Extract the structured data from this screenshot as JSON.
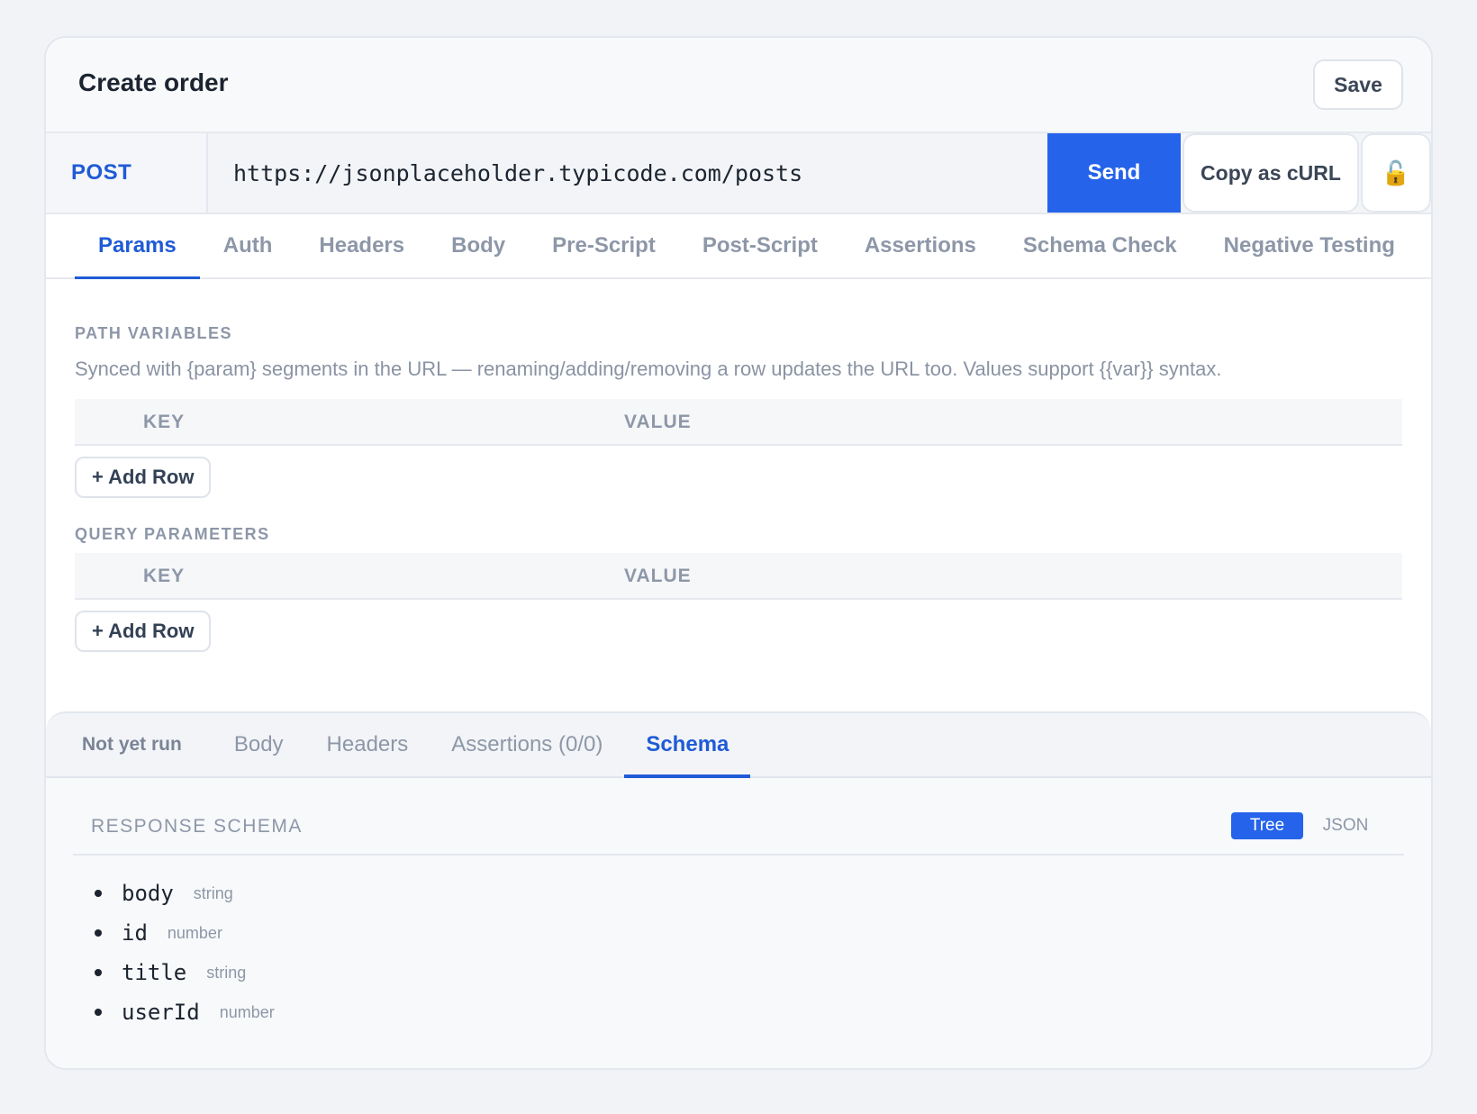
{
  "header": {
    "title": "Create order",
    "save_label": "Save"
  },
  "request": {
    "method": "POST",
    "url": "https://jsonplaceholder.typicode.com/posts",
    "send_label": "Send",
    "copy_curl_label": "Copy as cURL",
    "lock_icon": "lock-open-icon",
    "tabs": [
      "Params",
      "Auth",
      "Headers",
      "Body",
      "Pre-Script",
      "Post-Script",
      "Assertions",
      "Schema Check",
      "Negative Testing"
    ],
    "active_tab": "Params"
  },
  "params": {
    "path_label": "PATH VARIABLES",
    "path_help": "Synced with {param} segments in the URL — renaming/adding/removing a row updates the URL too. Values support {{var}} syntax.",
    "key_header": "KEY",
    "value_header": "VALUE",
    "add_row_label": "+ Add Row",
    "query_label": "QUERY PARAMETERS"
  },
  "response": {
    "status": "Not yet run",
    "tabs": [
      "Body",
      "Headers",
      "Assertions (0/0)",
      "Schema"
    ],
    "active_tab": "Schema",
    "schema_title": "RESPONSE SCHEMA",
    "view_tree": "Tree",
    "view_json": "JSON",
    "fields": [
      {
        "name": "body",
        "type": "string"
      },
      {
        "name": "id",
        "type": "number"
      },
      {
        "name": "title",
        "type": "string"
      },
      {
        "name": "userId",
        "type": "number"
      }
    ]
  },
  "colors": {
    "accent": "#2563eb",
    "lock": "#e7a10e"
  }
}
